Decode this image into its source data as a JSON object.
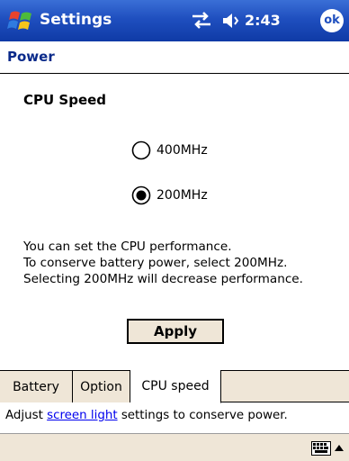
{
  "titlebar": {
    "app_title": "Settings",
    "clock": "2:43",
    "ok_label": "ok"
  },
  "page": {
    "header": "Power",
    "section_title": "CPU Speed"
  },
  "cpu_options": [
    {
      "label": "400MHz",
      "selected": false
    },
    {
      "label": "200MHz",
      "selected": true
    }
  ],
  "description": [
    "You can set the CPU performance.",
    "To conserve battery power, select 200MHz.",
    "Selecting 200MHz will decrease performance."
  ],
  "apply_label": "Apply",
  "tabs": [
    {
      "label": "Battery",
      "active": false
    },
    {
      "label": "Option",
      "active": false
    },
    {
      "label": "CPU speed",
      "active": true
    }
  ],
  "footer": {
    "prefix": "Adjust ",
    "link": "screen light",
    "suffix": " settings to conserve power."
  },
  "icons": {
    "start": "windows-start-icon",
    "connectivity": "connectivity-icon",
    "volume": "volume-icon",
    "keyboard": "keyboard-icon",
    "sip_arrow": "up-arrow-icon"
  },
  "colors": {
    "titlebar": "#1f4fbf",
    "header_text": "#0a2a8a",
    "chrome": "#efe6d7",
    "link": "#0000ee"
  }
}
